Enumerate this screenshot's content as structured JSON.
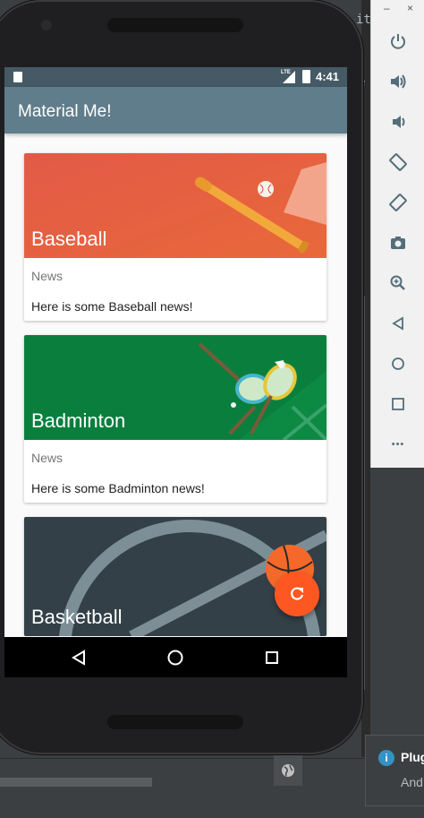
{
  "app": {
    "title": "Material Me!",
    "status_time": "4:41",
    "network_label": "LTE"
  },
  "cards": [
    {
      "title": "Baseball",
      "subtitle": "News",
      "info": "Here is some Baseball news!"
    },
    {
      "title": "Badminton",
      "subtitle": "News",
      "info": "Here is some Badminton news!"
    },
    {
      "title": "Basketball"
    }
  ],
  "fab": {
    "icon": "refresh-icon"
  },
  "nav": {
    "back": "back-icon",
    "home": "home-icon",
    "recents": "recents-icon"
  },
  "emulator_toolbar": {
    "minimize": "–",
    "close": "×",
    "buttons": [
      "power-icon",
      "volume-up-icon",
      "volume-down-icon",
      "rotate-left-icon",
      "rotate-right-icon",
      "camera-icon",
      "zoom-icon",
      "back-icon",
      "home-icon",
      "overview-icon",
      "more-icon"
    ],
    "more_label": "•••"
  },
  "ide": {
    "snippet_top": "ity",
    "snippet_mid": "e",
    "notification_title": "Plug",
    "notification_text": "And"
  },
  "colors": {
    "appbar": "#607d8b",
    "statusbar": "#455a64",
    "fab": "#ff5722",
    "baseball": "#e85f42",
    "badminton": "#0a7f3d",
    "basketball": "#334047"
  }
}
